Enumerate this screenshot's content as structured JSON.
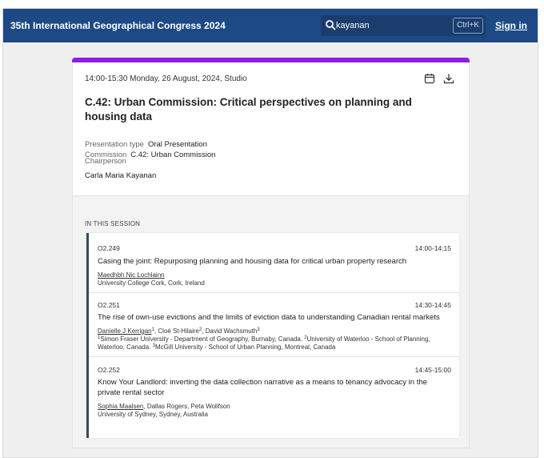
{
  "header": {
    "brand": "35th International Geographical Congress 2024",
    "search_value": "kayanan",
    "shortcut": "Ctrl+K",
    "sign_in": "Sign in"
  },
  "session": {
    "datetime": "14:00-15:30 Monday, 26 August, 2024, Studio",
    "title": "C.42: Urban Commission: Critical perspectives on planning and housing data",
    "presentation_type_label": "Presentation type",
    "presentation_type": "Oral Presentation",
    "commission_label": "Commission",
    "commission": "C.42: Urban Commission",
    "chairperson_label": "Chairperson",
    "chairperson": "Carla Maria Kayanan",
    "in_session_label": "IN THIS SESSION"
  },
  "papers": [
    {
      "code": "O2.249",
      "time": "14:00-14:15",
      "title": "Casing the joint: Repurposing planning and housing data for critical urban property research",
      "presenter": "Maedhbh Nic Lochlainn",
      "affiliation": "University College Cork, Cork, Ireland"
    },
    {
      "code": "O2.251",
      "time": "14:30-14:45",
      "title": "The rise of own-use evictions and the limits of eviction data to understanding Canadian rental markets",
      "presenter": "Danielle J Kerrigan",
      "presenter_sup": "1",
      "author2": "Cloé St-Hilaire",
      "author2_sup": "2",
      "author3": "David Wachsmuth",
      "author3_sup": "3",
      "aff1_sup": "1",
      "aff1": "Simon Fraser University - Department of Geography, Burnaby, Canada.",
      "aff2_sup": "2",
      "aff2": "University of Waterloo - School of Planning, Waterloo, Canada.",
      "aff3_sup": "3",
      "aff3": "McGill University - School of Urban Planning, Montreal, Canada"
    },
    {
      "code": "O2.252",
      "time": "14:45-15:00",
      "title": "Know Your Landlord: inverting the data collection narrative as a means to tenancy advocacy in the private rental sector",
      "presenter": "Sophia Maalsen",
      "coauthors": ", Dallas Rogers, Peta Wolifson",
      "affiliation": "University of Sydney, Sydney, Australia"
    }
  ],
  "colors": {
    "header_bg": "#1d4a85",
    "accent": "#8e1fe0"
  },
  "icons": [
    "search-icon",
    "calendar-icon",
    "download-icon"
  ]
}
